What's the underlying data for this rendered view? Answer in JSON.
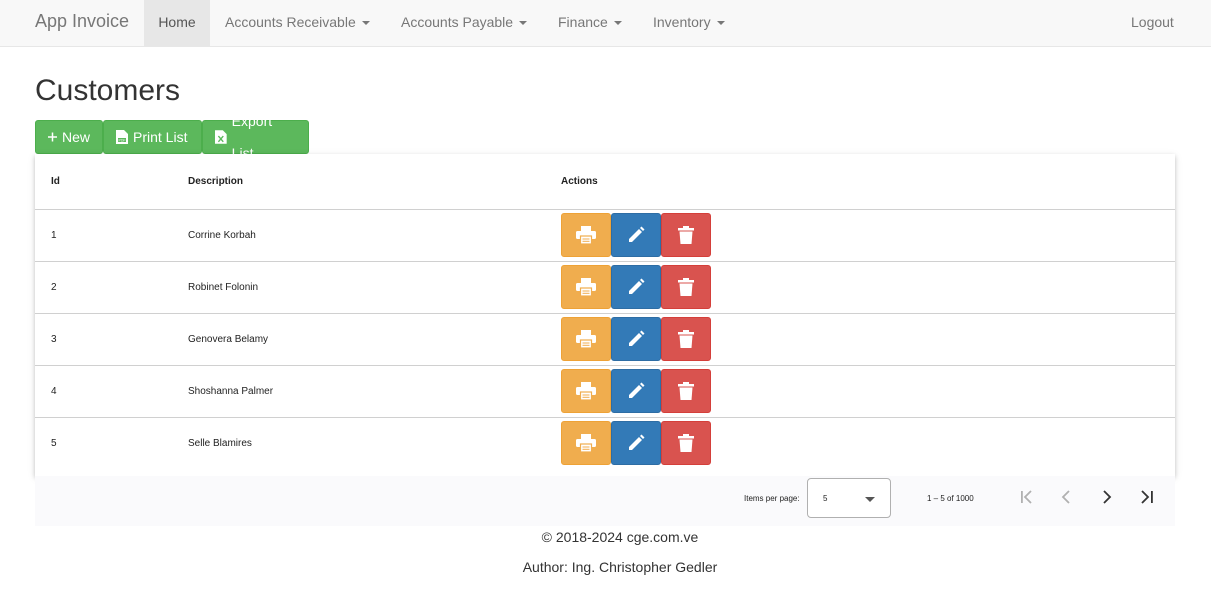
{
  "navbar": {
    "brand": "App Invoice",
    "items": [
      {
        "label": "Home",
        "active": true
      },
      {
        "label": "Accounts Receivable",
        "dropdown": true
      },
      {
        "label": "Accounts Payable",
        "dropdown": true
      },
      {
        "label": "Finance",
        "dropdown": true
      },
      {
        "label": "Inventory",
        "dropdown": true
      }
    ],
    "logout": "Logout"
  },
  "page": {
    "title": "Customers"
  },
  "toolbar": {
    "new_label": "New",
    "print_label": "Print List",
    "export_label": "Export List"
  },
  "table": {
    "headers": {
      "id": "Id",
      "description": "Description",
      "actions": "Actions"
    },
    "rows": [
      {
        "id": "1",
        "description": "Corrine Korbah"
      },
      {
        "id": "2",
        "description": "Robinet Folonin"
      },
      {
        "id": "3",
        "description": "Genovera Belamy"
      },
      {
        "id": "4",
        "description": "Shoshanna Palmer"
      },
      {
        "id": "5",
        "description": "Selle Blamires"
      }
    ],
    "action_icons": [
      "printer-icon",
      "pencil-icon",
      "trash-icon"
    ]
  },
  "paginator": {
    "items_per_page_label": "Items per page:",
    "items_per_page_value": "5",
    "range_label": "1 – 5 of 1000"
  },
  "footer": {
    "copyright": "© 2018-2024 cge.com.ve",
    "author": "Author: Ing. Christopher Gedler"
  },
  "colors": {
    "success": "#5cb85c",
    "warning": "#f0ad4e",
    "primary": "#337ab7",
    "danger": "#d9534f"
  }
}
